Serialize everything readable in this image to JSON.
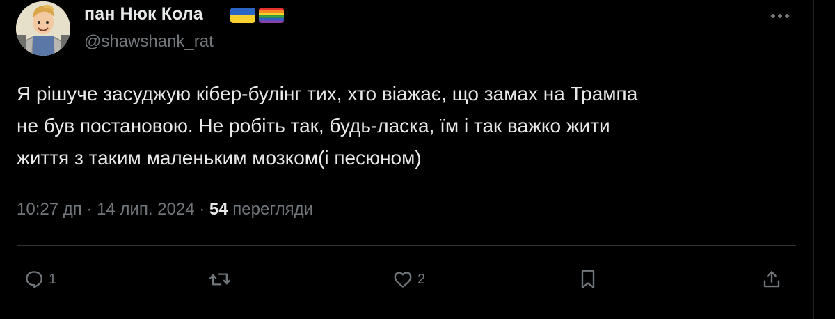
{
  "author": {
    "display_name": "пан Нюк Кола",
    "handle": "@shawshank_rat",
    "flags": [
      "ukraine-flag",
      "rainbow-flag"
    ]
  },
  "tweet": {
    "text": "Я рішуче засуджую кібер-булінг тих, хто віажає, що замах на Трампа\nне був постановою. Не робіть так, будь-ласка, їм і так важко жити\nжиття з таким маленьким мозком(і песюном)",
    "time": "10:27 дп",
    "separator": "·",
    "date": "14 лип. 2024",
    "views_count": "54",
    "views_label": "перегляди"
  },
  "actions": {
    "reply_count": "1",
    "retweet_count": "",
    "like_count": "2"
  },
  "colors": {
    "background": "#000000",
    "text_primary": "#e7e9ea",
    "text_secondary": "#71767b",
    "divider": "#2f3336"
  },
  "icons": [
    "more-icon",
    "reply-icon",
    "retweet-icon",
    "like-icon",
    "bookmark-icon",
    "share-icon"
  ]
}
